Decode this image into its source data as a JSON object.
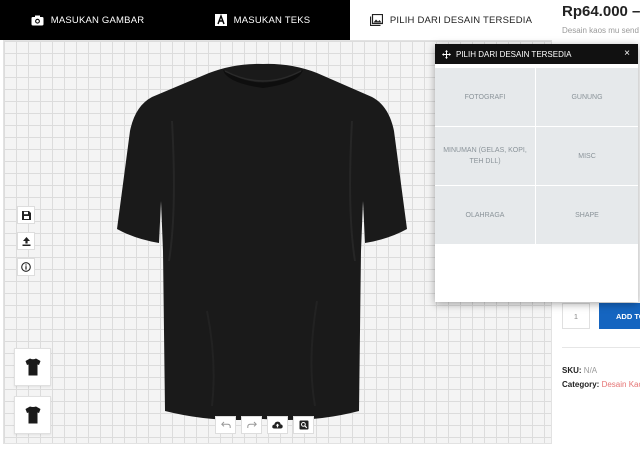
{
  "tabs": [
    {
      "label": "MASUKAN GAMBAR",
      "icon": "camera-icon"
    },
    {
      "label": "MASUKAN TEKS",
      "icon": "text-icon"
    },
    {
      "label": "PILIH DARI DESAIN TERSEDIA",
      "icon": "image-gallery-icon"
    }
  ],
  "product": {
    "price": "Rp64.000 –",
    "description": "Desain kaos mu send",
    "quantity": "1",
    "add_button": "ADD TO",
    "sku_label": "SKU:",
    "sku_value": "N/A",
    "category_label": "Category:",
    "category_value": "Desain Kao"
  },
  "left_tools": [
    {
      "name": "save-tool",
      "icon": "floppy-icon"
    },
    {
      "name": "upload-tool",
      "icon": "upload-icon"
    },
    {
      "name": "info-tool",
      "icon": "info-icon"
    }
  ],
  "bottom_tools": [
    {
      "name": "undo",
      "icon": "undo-icon"
    },
    {
      "name": "redo",
      "icon": "redo-icon"
    },
    {
      "name": "cloud-save",
      "icon": "cloud-upload-icon"
    },
    {
      "name": "zoom",
      "icon": "zoom-icon"
    }
  ],
  "popup": {
    "title": "PILIH DARI DESAIN TERSEDIA",
    "close": "×",
    "categories": [
      "FOTOGRAFI",
      "GUNUNG",
      "MINUMAN (GELAS, KOPI, TEH DLL)",
      "MISC",
      "OLAHRAGA",
      "SHAPE"
    ]
  },
  "colors": {
    "tab_bar": "#000000",
    "active_tab": "#ffffff",
    "add_button": "#1565c0",
    "category_link": "#e57373",
    "shirt": "#1a1a1a"
  }
}
